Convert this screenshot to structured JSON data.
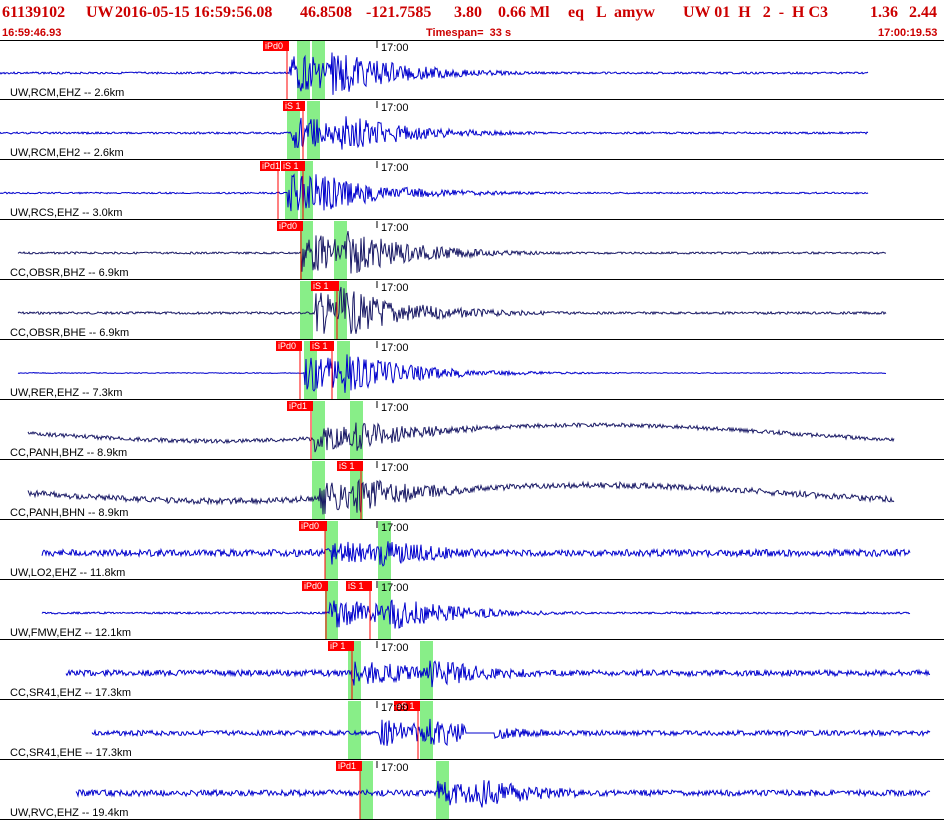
{
  "header": {
    "event_id": "61139102",
    "network": "UW",
    "origin_datetime": "2016-05-15 16:59:56.08",
    "latitude": "46.8508",
    "longitude": "-121.7585",
    "depth": "3.80",
    "magnitude": "0.66 Ml",
    "event_type": "eq",
    "flag": "L",
    "author": "amyw",
    "solution_fields": "UW 01  H   2  -  H C3",
    "value_a": "1.36",
    "value_b": "2.44"
  },
  "time_window": {
    "start": "16:59:46.93",
    "timespan": "Timespan=  33 s",
    "end": "17:00:19.53",
    "minute_mark": "17:00"
  },
  "colors": {
    "header_text": "#cc0000",
    "waveform_primary": "#0000cc",
    "waveform_dark": "#1a1a66",
    "pick_flag": "#ff0000",
    "pick_window": "#88ee88",
    "separator": "#000000"
  },
  "traces": [
    {
      "label": "UW,RCM,EHZ -- 2.6km",
      "style": "primary",
      "picks": [
        "iPd0"
      ]
    },
    {
      "label": "UW,RCM,EH2 -- 2.6km",
      "style": "primary",
      "picks": [
        "iS 1"
      ]
    },
    {
      "label": "UW,RCS,EHZ -- 3.0km",
      "style": "primary",
      "picks": [
        "iPd1",
        "iS 1"
      ]
    },
    {
      "label": "CC,OBSR,BHZ -- 6.9km",
      "style": "dark",
      "picks": [
        "iPd0"
      ]
    },
    {
      "label": "CC,OBSR,BHE -- 6.9km",
      "style": "dark",
      "picks": [
        "iS 1"
      ]
    },
    {
      "label": "UW,RER,EHZ -- 7.3km",
      "style": "primary",
      "picks": [
        "iPd0",
        "iS 1"
      ]
    },
    {
      "label": "CC,PANH,BHZ -- 8.9km",
      "style": "dark",
      "picks": [
        "iPd1"
      ]
    },
    {
      "label": "CC,PANH,BHN -- 8.9km",
      "style": "dark",
      "picks": [
        "iS 1"
      ]
    },
    {
      "label": "UW,LO2,EHZ -- 11.8km",
      "style": "primary",
      "picks": [
        "iPd0"
      ]
    },
    {
      "label": "UW,FMW,EHZ -- 12.1km",
      "style": "primary",
      "picks": [
        "iPd0",
        "iS 1"
      ]
    },
    {
      "label": "CC,SR41,EHZ -- 17.3km",
      "style": "primary",
      "picks": [
        "iP 1"
      ]
    },
    {
      "label": "CC,SR41,EHE -- 17.3km",
      "style": "primary",
      "picks": [
        "eS 1"
      ]
    },
    {
      "label": "UW,RVC,EHZ -- 19.4km",
      "style": "primary",
      "picks": [
        "iPd1"
      ]
    }
  ]
}
